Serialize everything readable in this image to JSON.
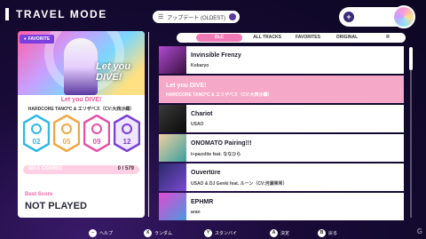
{
  "header": {
    "title": "TRAVEL MODE"
  },
  "sort": {
    "label": "アップデート (OLDEST)"
  },
  "profile": {
    "plus_icon": "plus-icon"
  },
  "selected_song": {
    "favorite_label": "FAVORITE",
    "jacket_text": "Let you DIVE!",
    "title": "Let you DIVE!",
    "artist": "HARDCORE TANO*C & エリザベス（CV:大西沙織）",
    "difficulties": [
      {
        "level": "02",
        "color": "#2fb8e6"
      },
      {
        "level": "05",
        "color": "#f2a640"
      },
      {
        "level": "09",
        "color": "#e64fa8"
      },
      {
        "level": "12",
        "color": "#7a3fd6"
      }
    ],
    "max_combo": {
      "label": "MAX COMBO",
      "value": "0 / 579",
      "progress": 0
    },
    "best_score": {
      "label": "Best Score",
      "value": "NOT PLAYED"
    }
  },
  "tabs": {
    "left_button": "L",
    "right_button": "R",
    "items": [
      {
        "label": "DLC",
        "active": true
      },
      {
        "label": "ALL TRACKS",
        "active": false
      },
      {
        "label": "FAVORITES",
        "active": false
      },
      {
        "label": "ORIGINAL",
        "active": false
      }
    ],
    "menu_icon": "more-icon"
  },
  "songs": [
    {
      "title": "Invinsible Frenzy",
      "artist": "Kobaryo",
      "thumb": "#6a2a7a"
    },
    {
      "title": "Let you DIVE!",
      "artist": "HARDCORE TANO*C & エリザベス（CV:大西沙織）",
      "selected": true
    },
    {
      "title": "Chariot",
      "artist": "USAO",
      "thumb": "#1a1a1a"
    },
    {
      "title": "ONOMATO Pairing!!!",
      "artist": "t+pazolite feat. ななひら",
      "thumb": "#d8b080"
    },
    {
      "title": "Ouvertüre",
      "artist": "USAO & DJ Genki feat. ルーン（CV:河瀬茉希）",
      "thumb": "#3a2a8a"
    },
    {
      "title": "EPHMR",
      "artist": "aran",
      "thumb": "#b04ad0"
    }
  ],
  "footer": {
    "hints": [
      {
        "key": "–",
        "label": "ヘルプ"
      },
      {
        "key": "X",
        "label": "ランダム"
      },
      {
        "key": "Y",
        "label": "スタンバイ"
      },
      {
        "key": "A",
        "label": "決定"
      },
      {
        "key": "B",
        "label": "戻る"
      }
    ],
    "watermark": "G"
  }
}
